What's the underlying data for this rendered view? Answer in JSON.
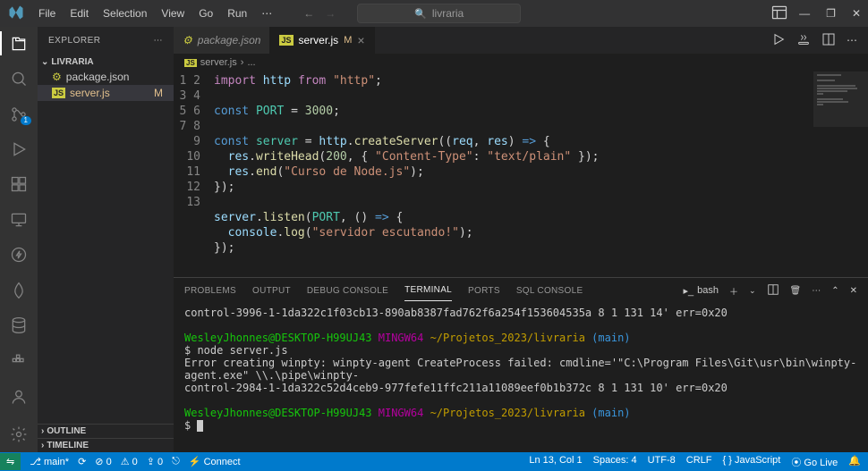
{
  "menubar": [
    "File",
    "Edit",
    "Selection",
    "View",
    "Go",
    "Run"
  ],
  "search_placeholder": "livraria",
  "sidebar": {
    "title": "EXPLORER",
    "project": "LIVRARIA",
    "files": [
      {
        "name": "package.json",
        "icon": "json",
        "modified": false
      },
      {
        "name": "server.js",
        "icon": "js",
        "modified": true,
        "active": true
      }
    ],
    "outline": "OUTLINE",
    "timeline": "TIMELINE"
  },
  "scm_badge": "1",
  "tabs": [
    {
      "name": "package.json",
      "icon": "json",
      "active": false
    },
    {
      "name": "server.js",
      "icon": "js",
      "active": true,
      "modified": "M",
      "close": true
    }
  ],
  "breadcrumb": {
    "file": "server.js",
    "sep": "›",
    "rest": "..."
  },
  "code_lines": 13,
  "panel_tabs": [
    "PROBLEMS",
    "OUTPUT",
    "DEBUG CONSOLE",
    "TERMINAL",
    "PORTS",
    "SQL CONSOLE"
  ],
  "panel_active": "TERMINAL",
  "terminal_profile": "bash",
  "terminal": {
    "l1": "control-3996-1-1da322c1f03cb13-890ab8387fad762f6a254f153604535a 8 1 131 14' err=0x20",
    "p1_user": "WesleyJhonnes@",
    "p1_host": "DESKTOP-H99UJ43",
    "p1_env": " MINGW64 ",
    "p1_path": "~/Projetos_2023/livraria",
    "p1_branch": " (main)",
    "cmd1": "$ node server.js",
    "err1": "Error creating winpty: winpty-agent CreateProcess failed: cmdline='\"C:\\Program Files\\Git\\usr\\bin\\winpty-agent.exe\" \\\\.\\pipe\\winpty-",
    "err2": "control-2984-1-1da322c52d4ceb9-977fefe11ffc211a11089eef0b1b372c 8 1 131 10' err=0x20",
    "prompt2": "$ "
  },
  "status": {
    "remote": "⇋",
    "branch": "main*",
    "sync": "⟳",
    "errors": "⊘ 0",
    "warnings": "⚠ 0",
    "ports": "⇪ 0",
    "wsl": "⎋",
    "connect": "Connect",
    "linecol": "Ln 13, Col 1",
    "spaces": "Spaces: 4",
    "encoding": "UTF-8",
    "eol": "CRLF",
    "lang": "{ } JavaScript",
    "golive": "⦿ Go Live",
    "bell": "🔔"
  }
}
